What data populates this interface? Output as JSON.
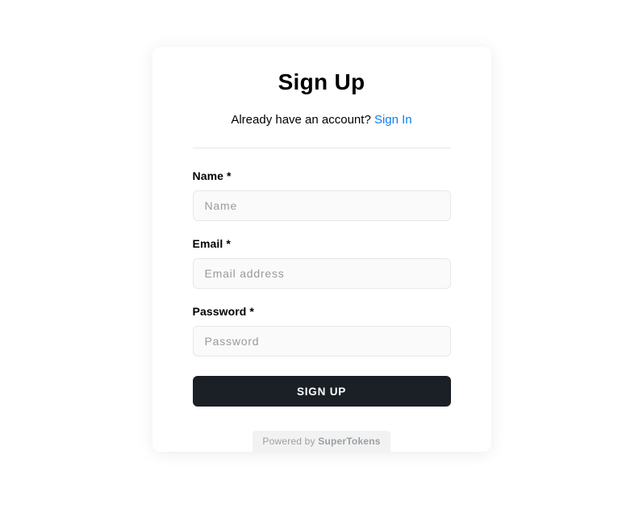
{
  "header": {
    "title": "Sign Up",
    "subtitle_text": "Already have an account? ",
    "subtitle_link": "Sign In"
  },
  "fields": {
    "name": {
      "label": "Name *",
      "placeholder": "Name",
      "value": ""
    },
    "email": {
      "label": "Email *",
      "placeholder": "Email address",
      "value": ""
    },
    "password": {
      "label": "Password *",
      "placeholder": "Password",
      "value": ""
    }
  },
  "submit": {
    "label": "SIGN UP"
  },
  "footer": {
    "prefix": "Powered by ",
    "brand": "SuperTokens"
  }
}
